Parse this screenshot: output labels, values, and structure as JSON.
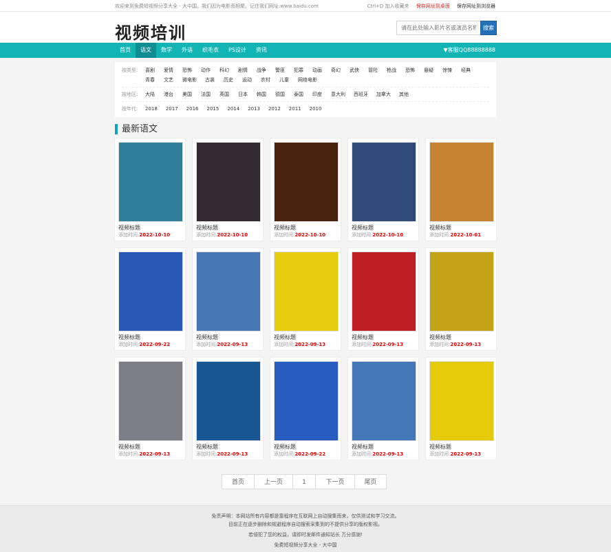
{
  "topbar": {
    "welcome": "欢迎来到免费短视频分享大全 - 大中国。我们因为电影而相聚。记住我们网址:www.baidu.com",
    "bookmark": "Ctrl+D 加入收藏夹",
    "save_desktop": "保存网址到桌面",
    "save_browser": "保存网址到浏览器"
  },
  "header": {
    "logo": "视频培训",
    "search_placeholder": "请在此处输入影片名或演员名称",
    "search_button": "搜索"
  },
  "nav": {
    "items": [
      "首页",
      "语文",
      "数学",
      "外语",
      "织毛衣",
      "PS设计",
      "资讯"
    ],
    "active_index": 1,
    "service": "▼客服QQ88888888"
  },
  "filters": [
    {
      "label": "按类型:",
      "items": [
        "喜剧",
        "爱情",
        "恐怖",
        "动作",
        "科幻",
        "剧情",
        "战争",
        "警匪",
        "犯罪",
        "动画",
        "奇幻",
        "武侠",
        "冒险",
        "枪战",
        "恐怖",
        "悬疑",
        "惊悚",
        "经典",
        "青春",
        "文艺",
        "微电影",
        "古装",
        "历史",
        "运动",
        "农村",
        "儿童",
        "网络电影"
      ]
    },
    {
      "label": "按地区:",
      "items": [
        "大陆",
        "港台",
        "美国",
        "法国",
        "英国",
        "日本",
        "韩国",
        "德国",
        "泰国",
        "印度",
        "意大利",
        "西班牙",
        "加拿大",
        "其他"
      ]
    },
    {
      "label": "按年代:",
      "items": [
        "2018",
        "2017",
        "2016",
        "2015",
        "2014",
        "2013",
        "2012",
        "2011",
        "2010"
      ]
    }
  ],
  "section_title": "最新语文",
  "date_label": "添加时间:",
  "cards": [
    {
      "title": "视频标题",
      "date": "2022-10-10",
      "color": "#2e7d99"
    },
    {
      "title": "视频标题",
      "date": "2022-10-10",
      "color": "#342832"
    },
    {
      "title": "视频标题",
      "date": "2022-10-10",
      "color": "#4a230e"
    },
    {
      "title": "视频标题",
      "date": "2022-10-10",
      "color": "#2d4a78"
    },
    {
      "title": "视频标题",
      "date": "2022-10-01",
      "color": "#c68433"
    },
    {
      "title": "视频标题",
      "date": "2022-09-22",
      "color": "#2859b8"
    },
    {
      "title": "视频标题",
      "date": "2022-09-13",
      "color": "#4678b6"
    },
    {
      "title": "视频标题",
      "date": "2022-09-13",
      "color": "#e7cc0f"
    },
    {
      "title": "视频标题",
      "date": "2022-09-13",
      "color": "#be1e23"
    },
    {
      "title": "视频标题",
      "date": "2022-09-13",
      "color": "#c4a318"
    },
    {
      "title": "视频标题",
      "date": "2022-09-13",
      "color": "#7c7d86"
    },
    {
      "title": "视频标题",
      "date": "2022-09-13",
      "color": "#185794"
    },
    {
      "title": "视频标题",
      "date": "2022-09-22",
      "color": "#295cc0"
    },
    {
      "title": "视频标题",
      "date": "2022-09-13",
      "color": "#4377b8"
    },
    {
      "title": "视频标题",
      "date": "2022-09-13",
      "color": "#e5cb0b"
    }
  ],
  "pager": {
    "first": "首页",
    "prev": "上一页",
    "current": "1",
    "next": "下一页",
    "last": "尾页"
  },
  "footer": {
    "line1": "免责声明：本网站所有内容都是靠程序在互联网上自动搜集而来，仅供测试和学习交流。",
    "line2": "目前正在逐步删除和规避程序自动搜索采集到的不提供分享的版权影视。",
    "line3": "若侵犯了您的权益，请即时发邮件通知站长 万分感谢!",
    "line4": "免费短视频分享大全 - 大中国"
  }
}
